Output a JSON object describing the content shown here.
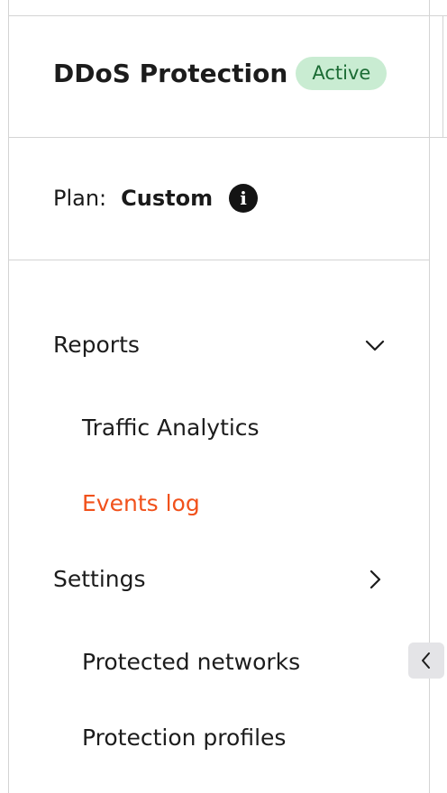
{
  "header": {
    "title": "DDoS Protection",
    "status_badge": "Active"
  },
  "plan": {
    "label": "Plan:",
    "value": "Custom",
    "info_icon": "info-icon"
  },
  "nav": {
    "groups": [
      {
        "label": "Reports",
        "expanded": true,
        "chevron": "chevron-down-icon",
        "items": [
          {
            "label": "Traffic Analytics",
            "active": false
          },
          {
            "label": "Events log",
            "active": true
          }
        ]
      },
      {
        "label": "Settings",
        "expanded": false,
        "chevron": "chevron-right-icon",
        "items": [
          {
            "label": "Protected networks",
            "active": false
          },
          {
            "label": "Protection profiles",
            "active": false
          }
        ]
      }
    ]
  },
  "collapse_button": {
    "icon": "chevron-left-icon"
  },
  "colors": {
    "accent_active": "#f1511b",
    "badge_bg": "#c9ecd2",
    "badge_text": "#1b6b34",
    "border": "#d4d4d4"
  }
}
